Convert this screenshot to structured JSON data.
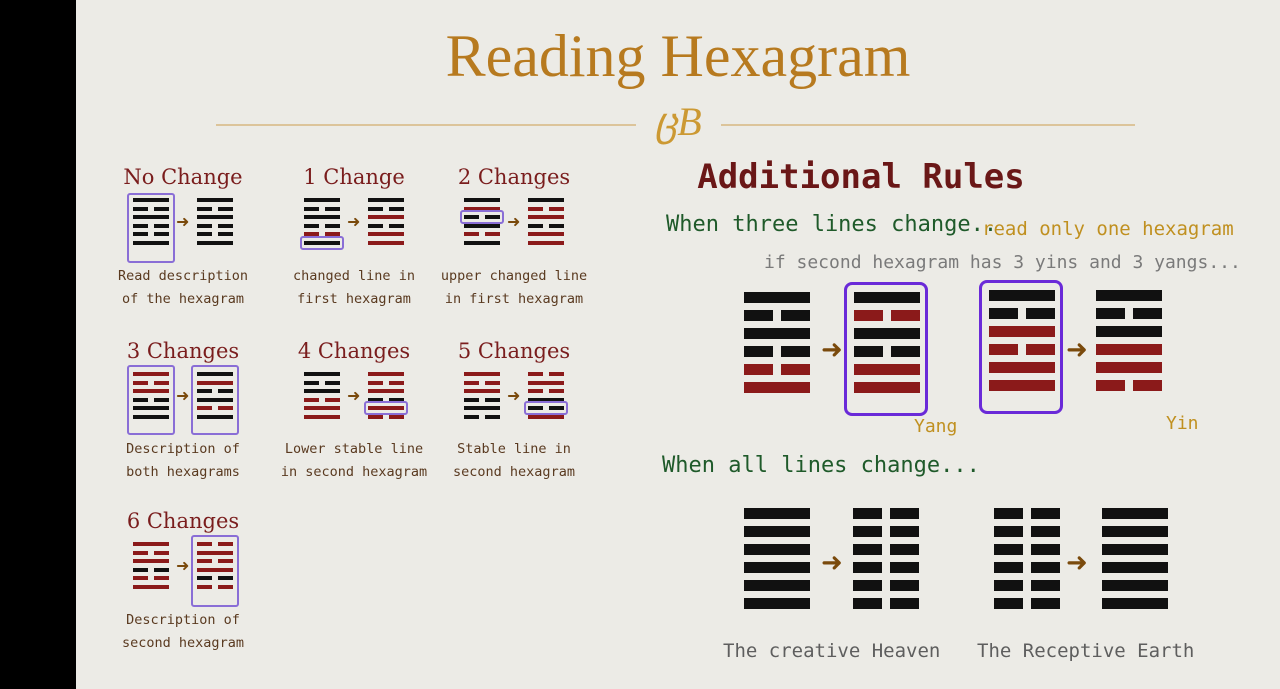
{
  "title": "Reading Hexagram",
  "flourish": "ცB",
  "colors": {
    "yang": "#111111",
    "red": "#8b1a1a",
    "highlight": "#8a6ed6",
    "accent": "#b77a1f"
  },
  "left_cases": [
    {
      "title": "No Change",
      "caption": [
        "Read description",
        "of the hexagram"
      ]
    },
    {
      "title": "1 Change",
      "caption": [
        "changed line in",
        "first hexagram"
      ]
    },
    {
      "title": "2 Changes",
      "caption": [
        "upper changed line",
        "in first hexagram"
      ]
    },
    {
      "title": "3 Changes",
      "caption": [
        "Description of",
        "both hexagrams"
      ]
    },
    {
      "title": "4 Changes",
      "caption": [
        "Lower stable line",
        "in second hexagram"
      ]
    },
    {
      "title": "5 Changes",
      "caption": [
        "Stable line in",
        "second hexagram"
      ]
    },
    {
      "title": "6 Changes",
      "caption": [
        "Description of",
        "second hexagram"
      ]
    }
  ],
  "right": {
    "title": "Additional Rules",
    "three_lines": "When three lines change..",
    "read_one": "read only one hexagram",
    "if_second": "if second hexagram has 3 yins and 3 yangs...",
    "yang_label": "Yang",
    "yin_label": "Yin",
    "all_lines": "When all lines change...",
    "creative": "The creative Heaven",
    "receptive": "The Receptive Earth"
  }
}
